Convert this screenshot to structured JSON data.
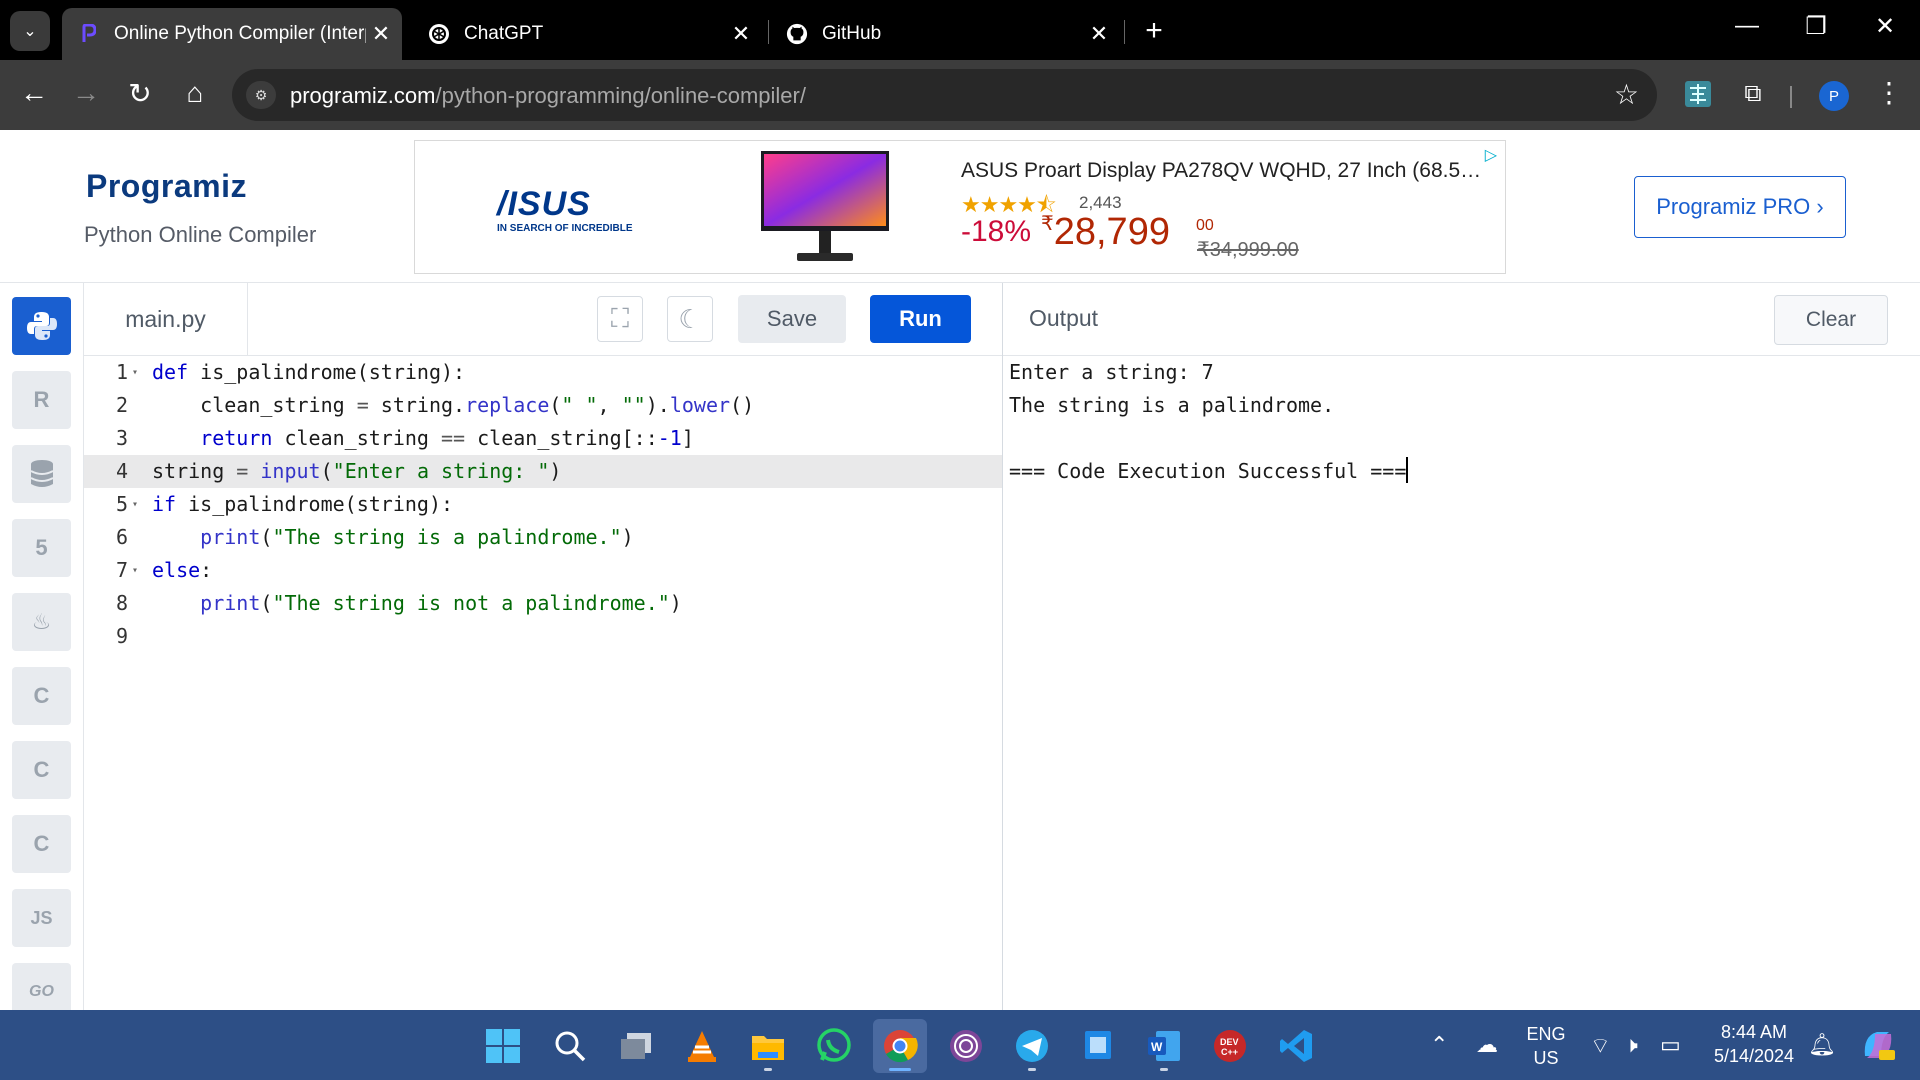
{
  "browser": {
    "tabs": [
      {
        "title": "Online Python Compiler (Interp",
        "icon": "programiz-favicon",
        "active": true
      },
      {
        "title": "ChatGPT",
        "icon": "chatgpt-icon",
        "active": false
      },
      {
        "title": "GitHub",
        "icon": "github-icon",
        "active": false
      }
    ],
    "url_host": "programiz.com",
    "url_path": "/python-programming/online-compiler/",
    "profile_initial": "P"
  },
  "header": {
    "logo": "Programiz",
    "subtitle": "Python Online Compiler",
    "pro_button": "Programiz PRO ›"
  },
  "ad": {
    "brand": "/ISUS",
    "tagline": "IN SEARCH OF INCREDIBLE",
    "product_title": "ASUS Proart Display PA278QV WQHD, 27 Inch (68.58…",
    "stars": "★★★★⯪",
    "reviews": "2,443",
    "discount": "-18%",
    "currency": "₹",
    "price": "28,799",
    "price_cents": "00",
    "mrp": "₹34,999.00"
  },
  "editor": {
    "filename": "main.py",
    "save_label": "Save",
    "run_label": "Run",
    "line_numbers": [
      "1",
      "2",
      "3",
      "4",
      "5",
      "6",
      "7",
      "8",
      "9"
    ],
    "code_lines": [
      "def is_palindrome(string):",
      "    clean_string = string.replace(\" \", \"\").lower()",
      "    return clean_string == clean_string[::-1]",
      "string = input(\"Enter a string: \")",
      "if is_palindrome(string):",
      "    print(\"The string is a palindrome.\")",
      "else:",
      "    print(\"The string is not a palindrome.\")",
      ""
    ]
  },
  "output": {
    "label": "Output",
    "clear_label": "Clear",
    "lines": [
      "Enter a string: 7",
      "The string is a palindrome.",
      "",
      "=== Code Execution Successful ==="
    ]
  },
  "languages": [
    {
      "name": "python",
      "label": "",
      "active": true
    },
    {
      "name": "r",
      "label": "R",
      "active": false
    },
    {
      "name": "sql",
      "label": "",
      "active": false
    },
    {
      "name": "html",
      "label": "5",
      "active": false
    },
    {
      "name": "java",
      "label": "",
      "active": false
    },
    {
      "name": "c",
      "label": "C",
      "active": false
    },
    {
      "name": "cpp",
      "label": "C",
      "active": false
    },
    {
      "name": "csharp",
      "label": "C",
      "active": false
    },
    {
      "name": "js",
      "label": "JS",
      "active": false
    },
    {
      "name": "go",
      "label": "GO",
      "active": false
    }
  ],
  "taskbar": {
    "language": "ENG",
    "region": "US",
    "time": "8:44 AM",
    "date": "5/14/2024"
  },
  "colors": {
    "accent": "#0556d9",
    "editor_highlight": "#e9e9ea",
    "taskbar": "#2d4f86"
  }
}
